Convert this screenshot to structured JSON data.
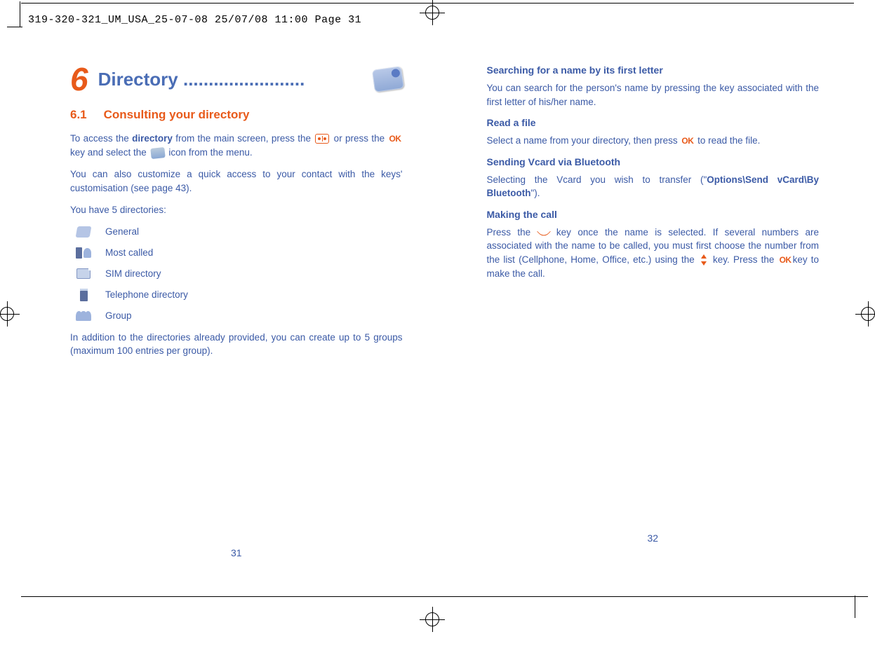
{
  "header": "319-320-321_UM_USA_25-07-08  25/07/08  11:00  Page 31",
  "left": {
    "chapter_number": "6",
    "chapter_title": "Directory ........................",
    "section_number": "6.1",
    "section_title": "Consulting your directory",
    "p1a": "To access the ",
    "p1_bold": "directory",
    "p1b": " from the main screen, press the ",
    "p1c": " or press the ",
    "p1d": " key and select the ",
    "p1e": " icon from the menu.",
    "p2": "You can also customize a quick access to your contact with the keys' customisation (see page 43).",
    "p3": "You have 5 directories:",
    "list": {
      "general": "General",
      "most_called": "Most called",
      "sim": "SIM directory",
      "telephone": "Telephone directory",
      "group": "Group"
    },
    "p4": "In addition to the directories already provided, you can create up to 5 groups (maximum 100 entries per group).",
    "page_number": "31"
  },
  "right": {
    "h1": "Searching for a name by its first letter",
    "p1": "You can search for the person's name by pressing the key associated with the first letter of his/her name.",
    "h2": "Read a file",
    "p2a": "Select a name from your directory, then press ",
    "p2b": " to read the file.",
    "h3": "Sending Vcard via Bluetooth",
    "p3a": "Selecting the Vcard you wish to transfer (\"",
    "p3_bold": "Options\\Send vCard\\By Bluetooth",
    "p3b": "\").",
    "h4": "Making the call",
    "p4a": "Press the ",
    "p4b": " key once the name is selected. If several numbers are associated with the name to be called, you must first choose the number from the list (Cellphone, Home, Office, etc.) using the ",
    "p4c": " key. Press the ",
    "p4d": "key to make the call.",
    "page_number": "32"
  },
  "icons": {
    "ok": "OK"
  }
}
